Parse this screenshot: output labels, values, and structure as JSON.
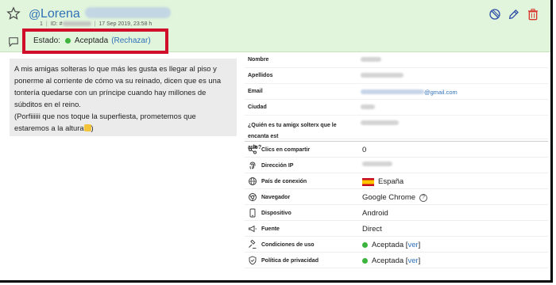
{
  "header": {
    "at": "@",
    "name": "Lorena",
    "meta_num": "1",
    "id_label": "ID: #",
    "datetime": "17 Sep 2019, 23:58 h"
  },
  "estado": {
    "label": "Estado:",
    "value": "Aceptada",
    "reject_link": "(Rechazar)"
  },
  "message": {
    "lines": [
      "A mis amigas solteras lo que más les gusta es llegar al piso y",
      "ponerme al corriente de cómo va su reinado, dicen que es una",
      "tontería quedarse con un príncipe cuando hay millones de",
      "súbditos en el reino.",
      "(Porfiiiiii que nos toque la superfiesta, prometemos que",
      "estaremos a la altura"
    ],
    "closing": ")"
  },
  "details": {
    "nombre": "Nombre",
    "apellidos": "Apellidos",
    "email": "Email",
    "email_domain": "@gmail.com",
    "ciudad": "Ciudad",
    "question_1": "¿Quién es tu amigx solterx que le encanta est",
    "question_2": "arlo?"
  },
  "info": {
    "clics": {
      "label": "Clics en compartir",
      "value": "0"
    },
    "ip": {
      "label": "Dirección IP"
    },
    "pais": {
      "label": "País de conexión",
      "value": "España"
    },
    "navegador": {
      "label": "Navegador",
      "value": "Google Chrome",
      "help": "?"
    },
    "dispositivo": {
      "label": "Dispositivo",
      "value": "Android"
    },
    "fuente": {
      "label": "Fuente",
      "value": "Direct"
    },
    "condiciones": {
      "label": "Condiciones de uso",
      "value": "Aceptada",
      "link": "ver",
      "open": "[",
      "close": "]"
    },
    "privacidad": {
      "label": "Política de privacidad",
      "value": "Aceptada",
      "link": "ver",
      "open": "[",
      "close": "]"
    }
  },
  "colors": {
    "header_bg": "#e1f4dc",
    "link": "#2f71b8",
    "status_green": "#3cb33c",
    "highlight_red": "#d0102b",
    "delete_red": "#d9342b"
  }
}
